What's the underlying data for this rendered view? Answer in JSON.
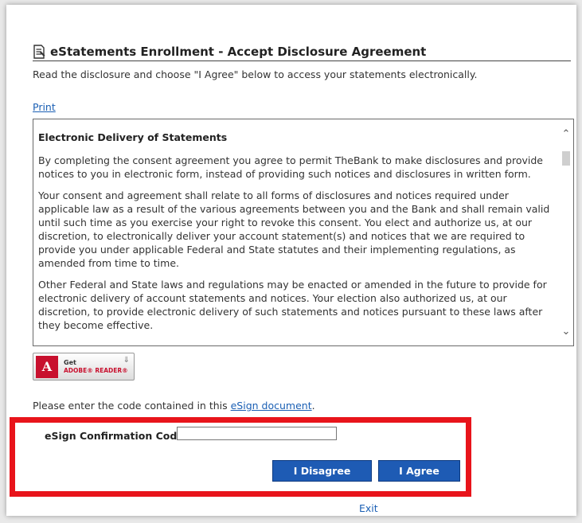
{
  "header": {
    "title": "eStatements Enrollment - Accept Disclosure Agreement",
    "icon": "document-icon"
  },
  "intro": "Read the disclosure and choose \"I Agree\" below to access your statements electronically.",
  "print_link": "Print",
  "disclosure": {
    "heading": "Electronic Delivery of Statements",
    "paragraphs": [
      "By completing the consent agreement you agree to permit TheBank to make disclosures and provide notices to you in electronic form, instead of providing such notices and disclosures in written form.",
      "Your consent and agreement shall relate to all forms of disclosures and notices required under applicable law as a result of the various agreements between you and the Bank and shall remain valid until such time as you exercise your right to revoke this consent. You elect and authorize us, at our discretion, to electronically deliver your account statement(s) and notices that we are required to provide you under applicable Federal and State statutes and their implementing regulations, as amended from time to time.",
      "Other Federal and State laws and regulations may be enacted or amended in the future to provide for electronic delivery of account statements and notices. Your election also authorized us, at our discretion, to provide electronic delivery of such statements and notices pursuant to these laws after they become effective."
    ]
  },
  "adobe": {
    "get": "Get",
    "reader": "ADOBE® READER®"
  },
  "code_instruction": {
    "prefix": "Please enter the code contained in this ",
    "link": "eSign document",
    "suffix": "."
  },
  "confirmation": {
    "label": "eSign Confirmation Code",
    "value": "",
    "placeholder": ""
  },
  "buttons": {
    "disagree": "I Disagree",
    "agree": "I Agree"
  },
  "exit_link": "Exit",
  "colors": {
    "button": "#1e5bb4",
    "link": "#1a5fb4",
    "highlight": "#e8141b"
  }
}
